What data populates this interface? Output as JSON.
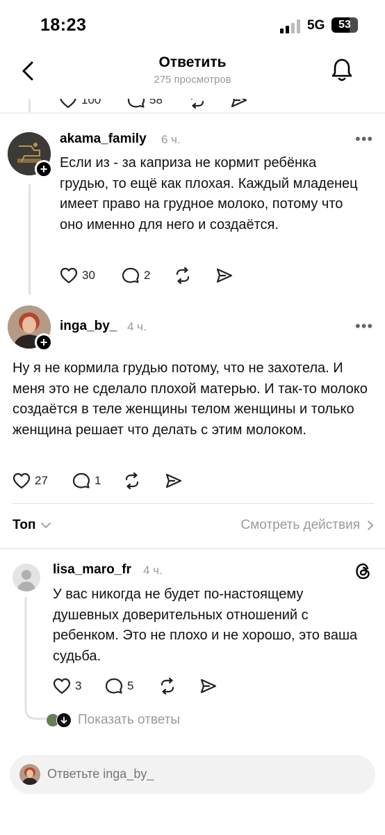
{
  "status_bar": {
    "time": "18:23",
    "network": "5G",
    "battery": "53"
  },
  "header": {
    "title": "Ответить",
    "subtitle": "275 просмотров"
  },
  "partial_post": {
    "likes": "100",
    "comments": "58"
  },
  "posts": [
    {
      "username": "akama_family",
      "time": "6 ч.",
      "text": "Если из - за каприза не кормит ребёнка грудью, то ещё как плохая. Каждый младенец имеет право на грудное молоко, потому что оно именно для него и создаётся.",
      "likes": "30",
      "comments": "2"
    },
    {
      "username": "inga_by_",
      "time": "4 ч.",
      "text": "Ну я не кормила грудью потому, что не захотела. И меня это не сделало плохой матерью. И так-то молоко создаётся в теле женщины телом женщины и только женщина решает что делать с этим молоком.",
      "likes": "27",
      "comments": "1"
    },
    {
      "username": "lisa_maro_fr",
      "time": "4 ч.",
      "text": "У вас никогда не будет по-настоящему душевных доверительных отношений с ребенком. Это не плохо и не хорошо, это ваша судьба.",
      "likes": "3",
      "comments": "5"
    }
  ],
  "sort": {
    "label": "Топ",
    "activity_link": "Смотреть действия"
  },
  "show_replies": "Показать ответы",
  "reply": {
    "placeholder": "Ответьте inga_by_"
  }
}
